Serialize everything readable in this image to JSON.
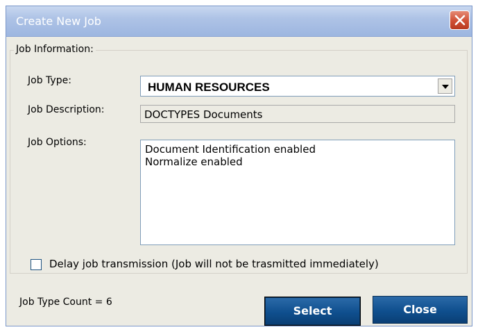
{
  "window": {
    "title": "Create New Job"
  },
  "job_information": {
    "legend": "Job Information:",
    "job_type_label": "Job Type:",
    "job_type_value": "HUMAN RESOURCES",
    "job_description_label": "Job Description:",
    "job_description_value": "DOCTYPES Documents",
    "job_options_label": "Job Options:",
    "job_options_lines": [
      "Document Identification enabled",
      "Normalize enabled"
    ],
    "delay_checkbox_label": "Delay job transmission (Job will not be trasmitted immediately)",
    "delay_checked": false
  },
  "footer": {
    "job_type_count": "Job Type Count = 6",
    "select_label": "Select",
    "close_label": "Close"
  },
  "icons": {
    "window_close": "close-icon",
    "dropdown": "chevron-down-icon"
  },
  "colors": {
    "button_blue": "#0f4f8e",
    "close_red": "#cf4f34",
    "title_blue": "#aec3e6"
  }
}
